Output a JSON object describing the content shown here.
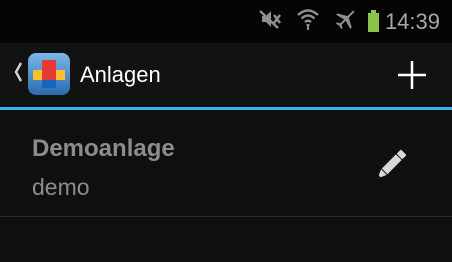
{
  "status_bar": {
    "time": "14:39",
    "icons": [
      "mute-icon",
      "wifi-icon",
      "airplane-mode-icon",
      "battery-icon"
    ],
    "battery_color": "#8bc34a"
  },
  "action_bar": {
    "title": "Anlagen",
    "back_icon": "chevron-left-icon",
    "add_icon": "plus-icon"
  },
  "accent_color": "#33b5e5",
  "list": {
    "items": [
      {
        "title": "Demoanlage",
        "subtitle": "demo",
        "action_icon": "pencil-icon"
      }
    ]
  }
}
